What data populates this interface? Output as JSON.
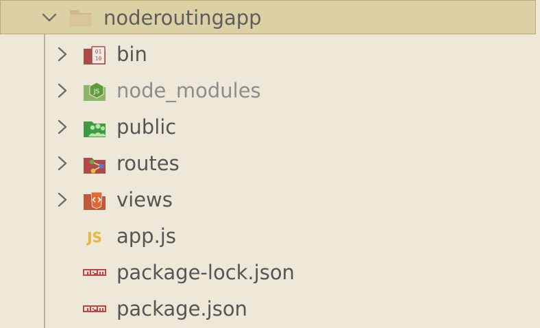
{
  "explorer": {
    "root": {
      "label": "noderoutingapp",
      "icon": "folder-icon",
      "expanded": true
    },
    "items": [
      {
        "label": "bin",
        "type": "folder",
        "icon": "folder-bin-icon",
        "dimmed": false
      },
      {
        "label": "node_modules",
        "type": "folder",
        "icon": "folder-node-icon",
        "dimmed": true
      },
      {
        "label": "public",
        "type": "folder",
        "icon": "folder-public-icon",
        "dimmed": false
      },
      {
        "label": "routes",
        "type": "folder",
        "icon": "folder-routes-icon",
        "dimmed": false
      },
      {
        "label": "views",
        "type": "folder",
        "icon": "folder-views-icon",
        "dimmed": false
      },
      {
        "label": "app.js",
        "type": "file",
        "icon": "javascript-icon",
        "dimmed": false
      },
      {
        "label": "package-lock.json",
        "type": "file",
        "icon": "npm-icon",
        "dimmed": false
      },
      {
        "label": "package.json",
        "type": "file",
        "icon": "npm-icon",
        "dimmed": false
      }
    ]
  },
  "colors": {
    "background": "#ede8d8",
    "selected_row": "#dcd1a4",
    "text": "#555555",
    "dimmed_text": "#8c8c8c"
  }
}
